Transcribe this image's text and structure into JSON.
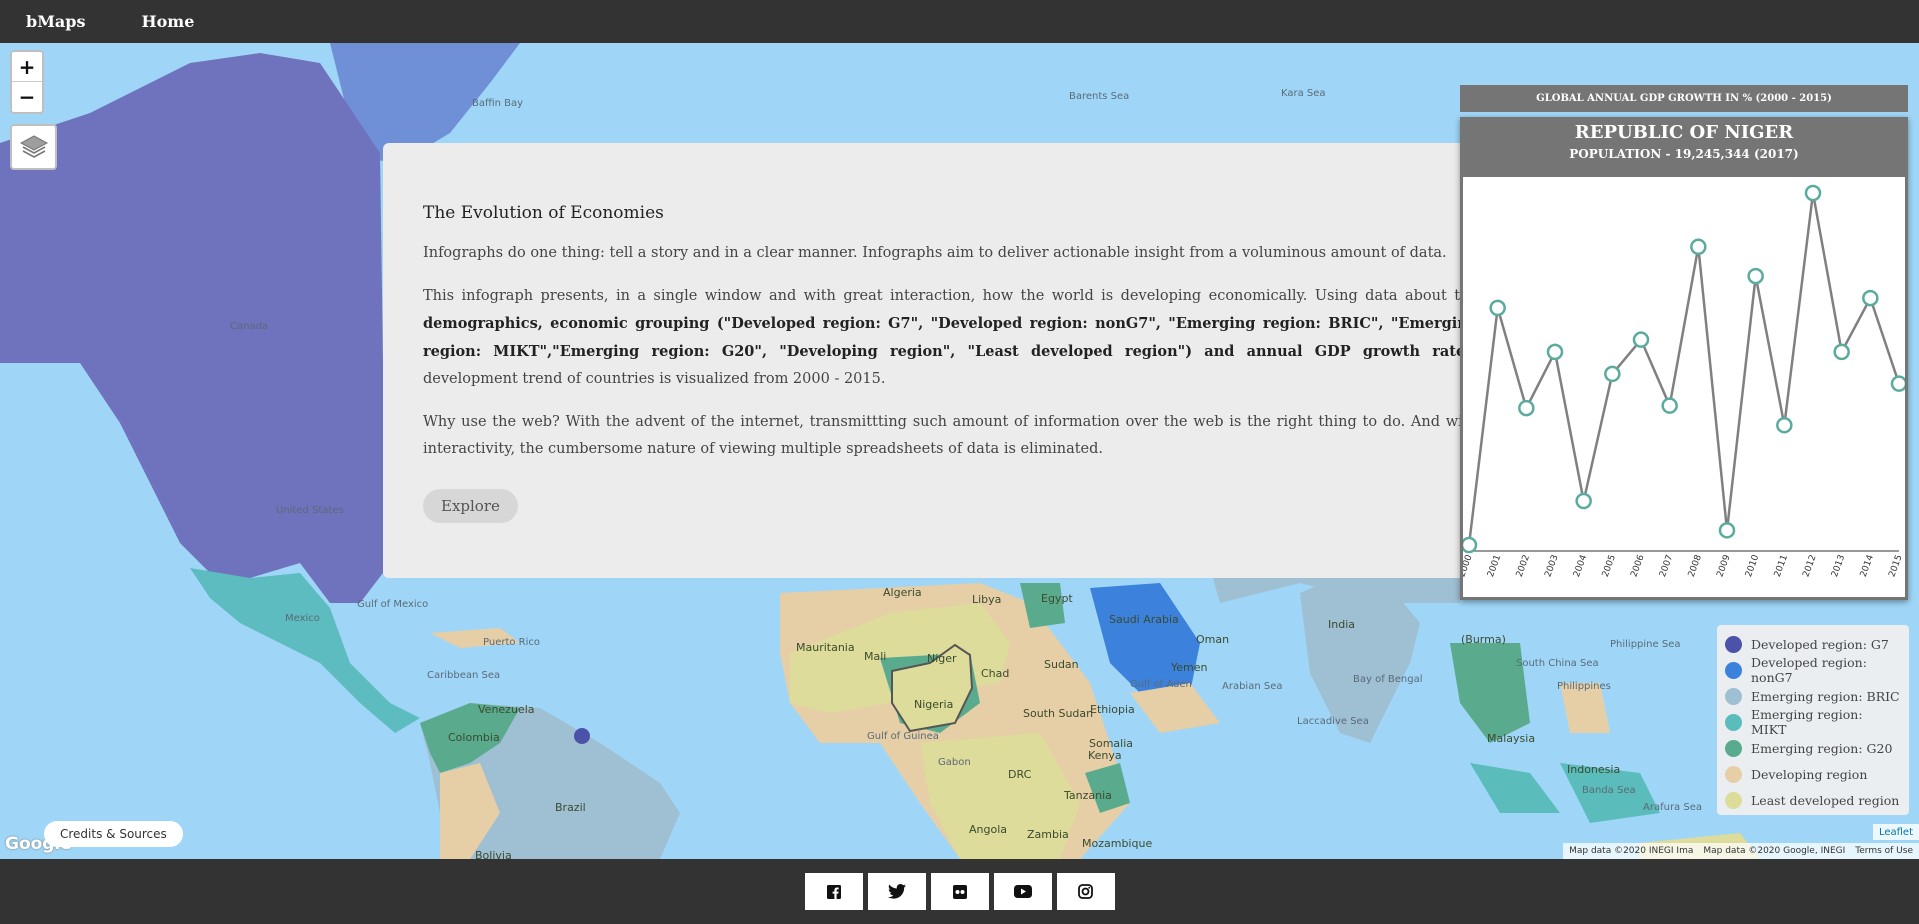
{
  "nav": {
    "brand": "bMaps",
    "home": "Home"
  },
  "map": {
    "zoom_in": "+",
    "zoom_out": "−",
    "credits": "Credits & Sources",
    "google": "Google",
    "leaflet": "Leaflet",
    "attribution_1": "Map data ©2020 INEGI Ima",
    "attribution_2": "Map data ©2020 Google, INEGI",
    "terms": "Terms of Use",
    "places": {
      "baffin_bay": "Baffin Bay",
      "barents_sea": "Barents Sea",
      "kara_sea": "Kara Sea",
      "canada": "Canada",
      "united_states": "United States",
      "mexico": "Mexico",
      "gulf_of_mexico": "Gulf of Mexico",
      "puerto_rico": "Puerto Rico",
      "caribbean_sea": "Caribbean Sea",
      "venezuela": "Venezuela",
      "colombia": "Colombia",
      "brazil": "Brazil",
      "bolivia": "Bolivia",
      "algeria": "Algeria",
      "libya": "Libya",
      "egypt": "Egypt",
      "mauritania": "Mauritania",
      "mali": "Mali",
      "niger": "Niger",
      "chad": "Chad",
      "sudan": "Sudan",
      "nigeria": "Nigeria",
      "south_sudan": "South Sudan",
      "ethiopia": "Ethiopia",
      "somalia": "Somalia",
      "kenya": "Kenya",
      "drc": "DRC",
      "tanzania": "Tanzania",
      "angola": "Angola",
      "zambia": "Zambia",
      "mozambique": "Mozambique",
      "gulf_of_guinea": "Gulf of Guinea",
      "gabon": "Gabon",
      "saudi_arabia": "Saudi Arabia",
      "yemen": "Yemen",
      "oman": "Oman",
      "gulf_of_aden": "Gulf of Aden",
      "arabian_sea": "Arabian Sea",
      "laccadive_sea": "Laccadive Sea",
      "india": "India",
      "bay_of_bengal": "Bay of Bengal",
      "burma": "(Burma)",
      "south_china_sea": "South China Sea",
      "philippine_sea": "Philippine Sea",
      "philippines": "Philippines",
      "malaysia": "Malaysia",
      "indonesia": "Indonesia",
      "banda_sea": "Banda Sea",
      "arafura_sea": "Arafura Sea"
    }
  },
  "info": {
    "title": "The Evolution of Economies",
    "p1": "Infographs do one thing: tell a story and in a clear manner. Infographs aim to deliver actionable insight from a voluminous amount of data.",
    "p2_start": "This infograph presents, in a single window and with great interaction, how the world is developing economically. Using data about the ",
    "p2_bold": "demographics, economic grouping (\"Developed region: G7\", \"Developed region: nonG7\", \"Emerging region: BRIC\", \"Emerging region: MIKT\",\"Emerging region: G20\", \"Developing region\", \"Least developed region\") and annual GDP growth rates",
    "p2_end": ", development trend of countries is visualized from 2000 - 2015.",
    "p3": "Why use the web? With the advent of the internet, transmittting such amount of information over the web is the right thing to do. And with interactivity, the cumbersome nature of viewing multiple spreadsheets of data is eliminated.",
    "explore": "Explore"
  },
  "chart_panel": {
    "header": "GLOBAL ANNUAL GDP GROWTH IN % (2000 - 2015)",
    "title": "REPUBLIC OF NIGER",
    "subtitle": "POPULATION - 19,245,344 (2017)"
  },
  "chart_data": {
    "type": "line",
    "title": "GLOBAL ANNUAL GDP GROWTH IN % (2000 - 2015)",
    "categories": [
      "2000",
      "2001",
      "2002",
      "2003",
      "2004",
      "2005",
      "2006",
      "2007",
      "2008",
      "2009",
      "2010",
      "2011",
      "2012",
      "2013",
      "2014",
      "2015"
    ],
    "series": [
      {
        "name": "",
        "values": [
          -2.6,
          7.1,
          3.0,
          5.3,
          -0.8,
          4.4,
          5.8,
          3.1,
          9.6,
          -2.0,
          8.4,
          2.3,
          11.8,
          5.3,
          7.5,
          4.0
        ]
      }
    ],
    "ylim": [
      -2.6,
      11.8
    ],
    "grid": false,
    "line_color": "#808080",
    "marker_color": "#5aab9e"
  },
  "legend": [
    {
      "label": "Developed region: G7",
      "color": "#4b52a8"
    },
    {
      "label": "Developed region: nonG7",
      "color": "#3c82dc"
    },
    {
      "label": "Emerging region: BRIC",
      "color": "#9fbfd2"
    },
    {
      "label": "Emerging region: MIKT",
      "color": "#5bbcbc"
    },
    {
      "label": "Emerging region: G20",
      "color": "#5aab8e"
    },
    {
      "label": "Developing region",
      "color": "#e6cfa6"
    },
    {
      "label": "Least developed region",
      "color": "#dddc9a"
    }
  ],
  "footer": {
    "icons": [
      "facebook-icon",
      "twitter-icon",
      "flickr-icon",
      "youtube-icon",
      "instagram-icon"
    ]
  }
}
